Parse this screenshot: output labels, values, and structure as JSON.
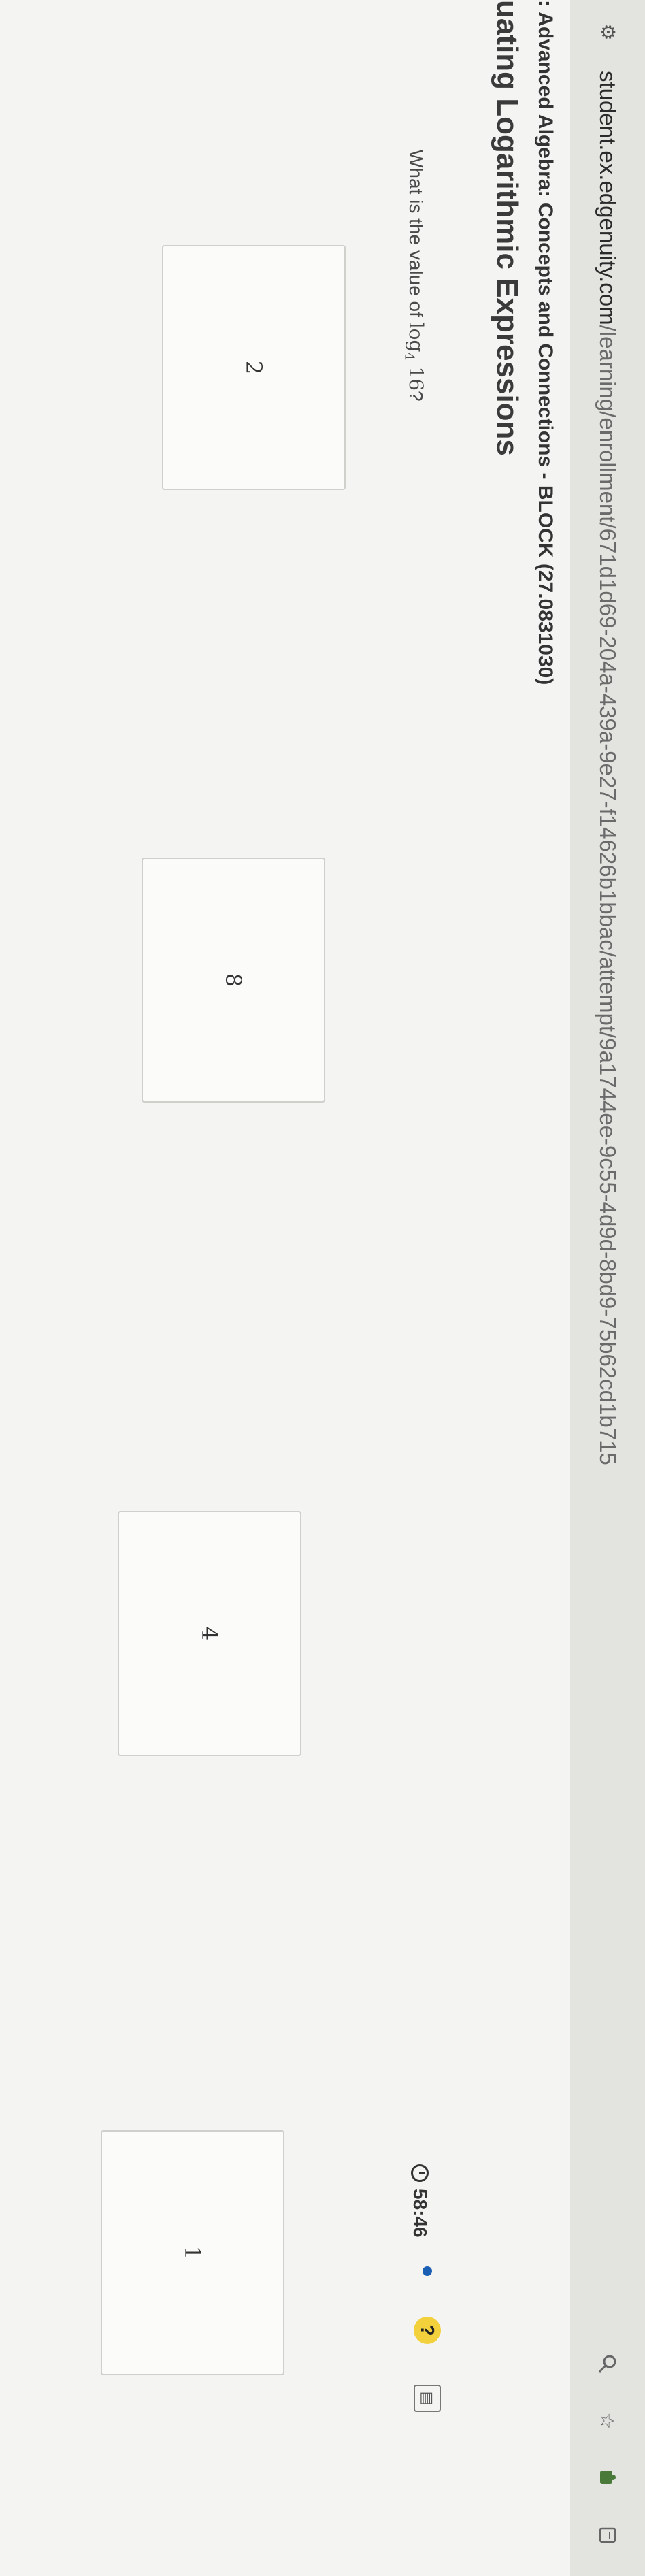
{
  "browser": {
    "url_host": "student.ex.edgenuity.com",
    "url_path": "/learning/enrollment/671d1d69-204a-439a-9e27-f14626b1bbac/attempt/9a1744ee-9c55-4d9d-8bd9-75b62cd1b715",
    "site_icon": "tune-icon",
    "icons": [
      "zoom-icon",
      "star-icon",
      "extension-icon",
      "profile-icon"
    ]
  },
  "course": {
    "title": ": Advanced Algebra: Concepts and Connections - BLOCK (27.0831030)",
    "lesson": "uating Logarithmic Expressions"
  },
  "question": {
    "prefix": "What is the value of ",
    "log_base": "4",
    "log_arg": "16",
    "suffix": "?"
  },
  "timer": {
    "value": "58:46"
  },
  "answers": [
    {
      "label": "2"
    },
    {
      "label": "8"
    },
    {
      "label": "4"
    },
    {
      "label": "1"
    }
  ],
  "colors": {
    "progress_dot": "#1a5fb4",
    "help": "#f2d13c"
  }
}
